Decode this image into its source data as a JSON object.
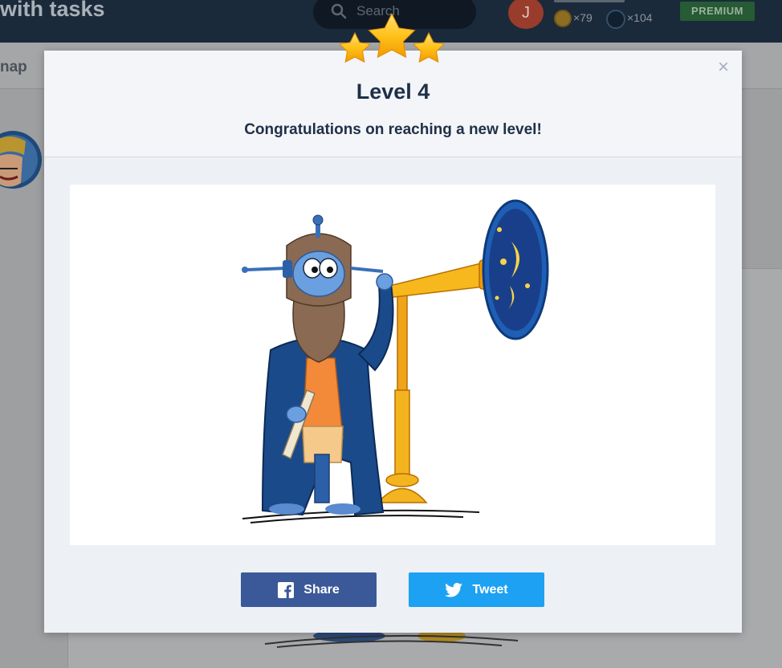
{
  "background": {
    "page_title": "with tasks",
    "search_placeholder": "Search",
    "user_initial": "J",
    "coins": "×79",
    "orbs": "×104",
    "premium_label": "PREMIUM",
    "nav_tab": "nap"
  },
  "modal": {
    "close_symbol": "×",
    "level_title": "Level 4",
    "message": "Congratulations on reaching a new level!",
    "share_label": "Share",
    "tweet_label": "Tweet"
  },
  "colors": {
    "facebook": "#3b5998",
    "twitter": "#1da1f2",
    "title_text": "#1e3047",
    "star": "#f7b500"
  },
  "icons": {
    "stars": "star-icon",
    "close": "close-icon",
    "share": "facebook-icon",
    "tweet": "twitter-icon",
    "search": "search-icon"
  }
}
